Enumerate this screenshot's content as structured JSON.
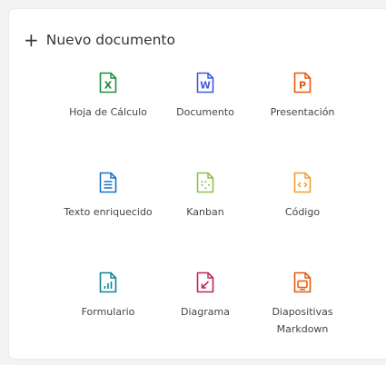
{
  "header": {
    "label": "Nuevo documento"
  },
  "items": [
    {
      "label": "Hoja de Cálculo",
      "icon": "spreadsheet-icon",
      "color": "#1e8e3e"
    },
    {
      "label": "Documento",
      "icon": "document-word-icon",
      "color": "#3b5bdb"
    },
    {
      "label": "Presentación",
      "icon": "presentation-icon",
      "color": "#e8590c"
    },
    {
      "label": "Texto enriquecido",
      "icon": "rich-text-icon",
      "color": "#1971c2"
    },
    {
      "label": "Kanban",
      "icon": "kanban-icon",
      "color": "#8cc152"
    },
    {
      "label": "Código",
      "icon": "code-icon",
      "color": "#f0a030"
    },
    {
      "label": "Formulario",
      "icon": "form-icon",
      "color": "#0c8599"
    },
    {
      "label": "Diagrama",
      "icon": "diagram-icon",
      "color": "#c2255c"
    },
    {
      "label": "Diapositivas Markdown",
      "icon": "markdown-slides-icon",
      "color": "#e8590c"
    }
  ]
}
